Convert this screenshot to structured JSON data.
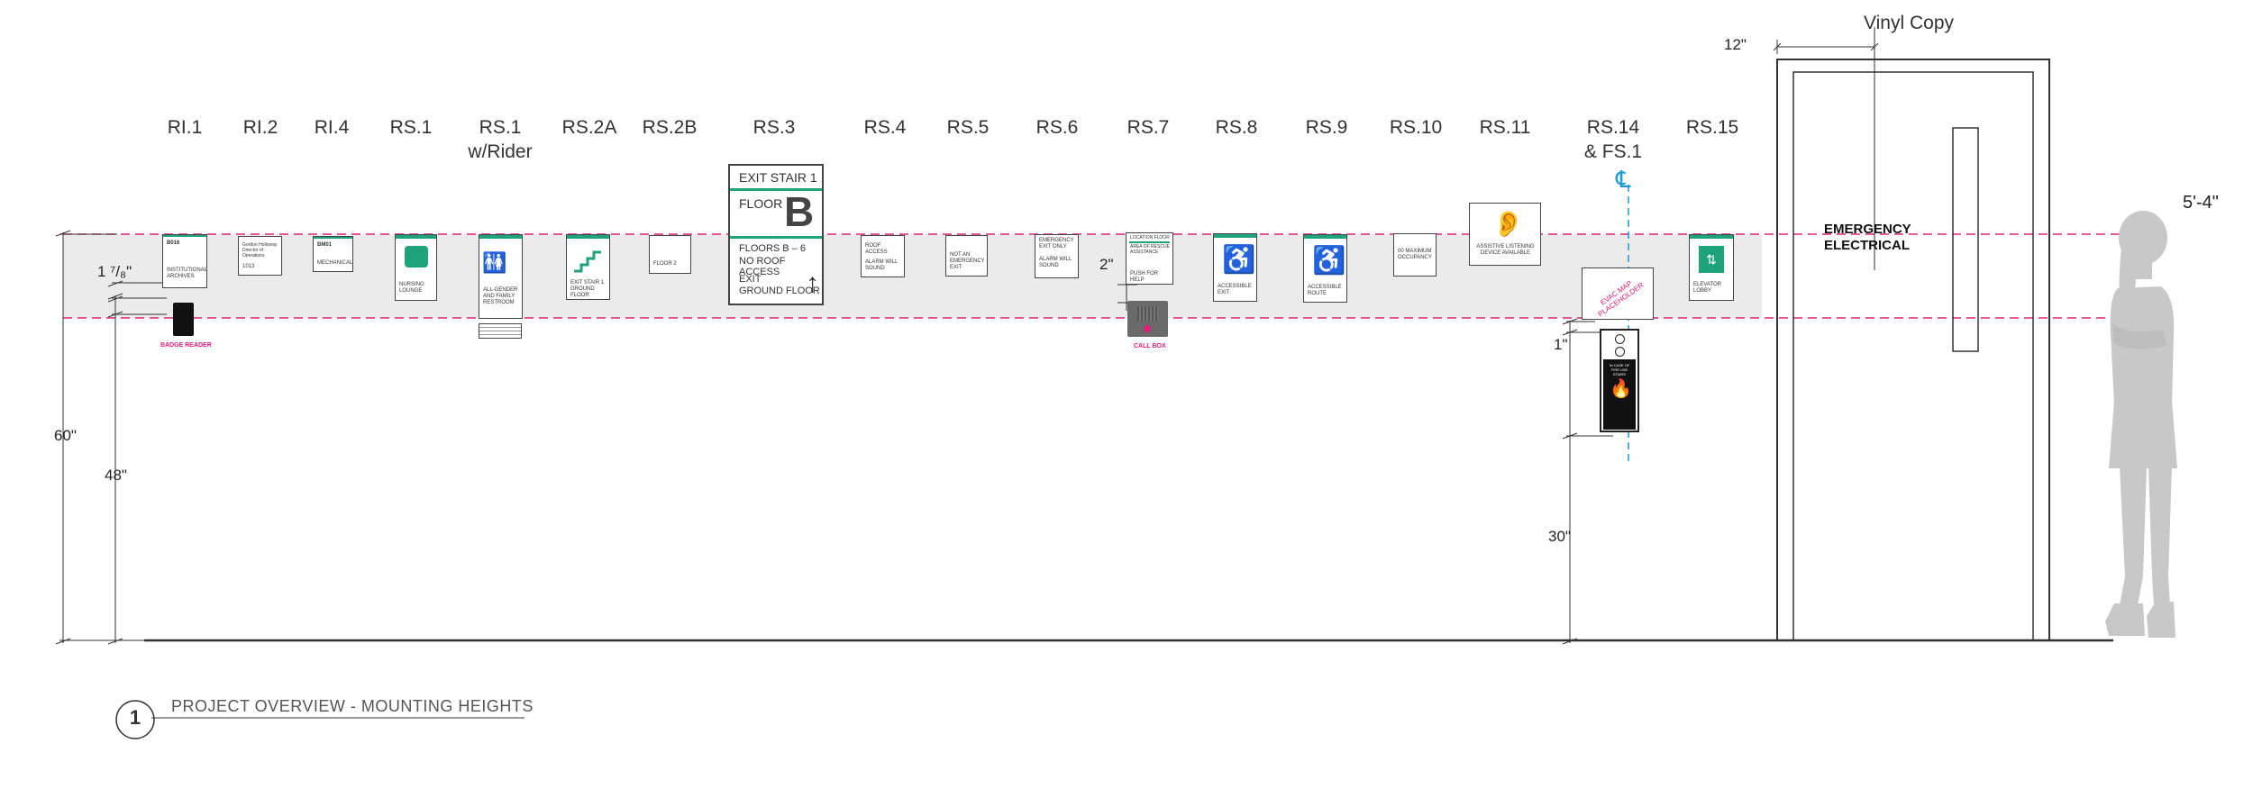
{
  "labels": {
    "ri1": "RI.1",
    "ri2": "RI.2",
    "ri4": "RI.4",
    "rs1": "RS.1",
    "rs1_rider": "RS.1",
    "rs1_rider_2": "w/Rider",
    "rs2a": "RS.2A",
    "rs2b": "RS.2B",
    "rs3": "RS.3",
    "rs4": "RS.4",
    "rs5": "RS.5",
    "rs6": "RS.6",
    "rs7": "RS.7",
    "rs8": "RS.8",
    "rs9": "RS.9",
    "rs10": "RS.10",
    "rs11": "RS.11",
    "rs14": "RS.14",
    "rs14_2": "& FS.1",
    "rs15": "RS.15"
  },
  "vinyl_copy": "Vinyl Copy",
  "door_text": {
    "line1": "EMERGENCY",
    "line2": "ELECTRICAL"
  },
  "dimensions": {
    "d12": "12\"",
    "d1_78": "1 ⁷/₈\"",
    "d60": "60\"",
    "d48": "48\"",
    "d2": "2\"",
    "d1": "1\"",
    "d30": "30\"",
    "height": "5'-4\""
  },
  "centerline": "℄",
  "badge_reader": "BADGE READER",
  "call_box": "CALL BOX",
  "evac_map": "EVAC MAP PLACEHOLDER",
  "signs": {
    "ri1": {
      "num": "B016",
      "text": "INSTITUTIONAL ARCHIVES"
    },
    "ri2": {
      "title": "Gordon Holloway Director of Operations",
      "num": "1013"
    },
    "ri4": {
      "num": "BM01",
      "text": "MECHANICAL"
    },
    "rs1": {
      "text": "NURSING LOUNGE"
    },
    "rs1r": {
      "text": "ALL-GENDER AND FAMILY RESTROOM"
    },
    "rs2a": {
      "text": "EXIT STAIR 1 GROUND FLOOR"
    },
    "rs2b": {
      "text": "FLOOR 2"
    },
    "rs3": {
      "title": "EXIT STAIR 1",
      "floor": "FLOOR",
      "letter": "B",
      "floors": "FLOORS B – 6",
      "noroof": "NO ROOF ACCESS",
      "exit": "EXIT",
      "ground": "GROUND FLOOR",
      "arrow": "↑"
    },
    "rs4": {
      "t1": "ROOF ACCESS",
      "t2": "ALARM WILL SOUND"
    },
    "rs5": {
      "text": "NOT AN EMERGENCY EXIT"
    },
    "rs6": {
      "t1": "EMERGENCY EXIT ONLY",
      "t2": "ALARM WILL SOUND"
    },
    "rs7": {
      "top": "LOCATION FLOOR",
      "mid": "AREA OF RESCUE ASSISTANCE",
      "help": "PUSH FOR HELP"
    },
    "rs8": {
      "text": "ACCESSIBLE EXIT"
    },
    "rs9": {
      "text": "ACCESSIBLE ROUTE"
    },
    "rs10": {
      "text": "00 MAXIMUM OCCUPANCY"
    },
    "rs11": {
      "text": "ASSISTIVE LISTENING DEVICE AVAILABLE"
    },
    "rs15": {
      "text": "ELEVATOR LOBBY"
    }
  },
  "fire_panel": {
    "title": "IN CASE OF FIRE USE STAIRS"
  },
  "footer": {
    "number": "1",
    "title": "PROJECT OVERVIEW - MOUNTING HEIGHTS"
  },
  "colors": {
    "accent": "#1fa37a",
    "pink": "#e0207a",
    "blue": "#1e9bd7"
  }
}
